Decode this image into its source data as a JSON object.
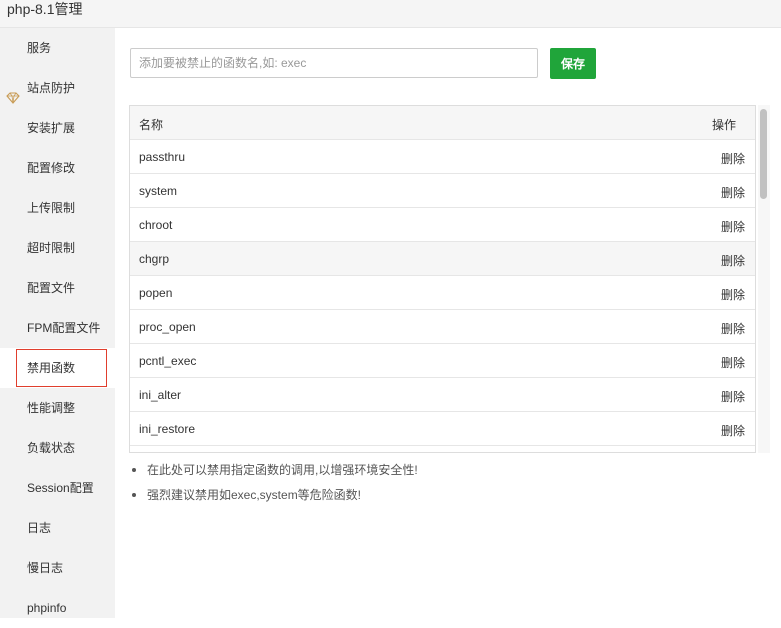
{
  "window": {
    "title": "php-8.1管理"
  },
  "sidebar": {
    "items": [
      {
        "label": "服务"
      },
      {
        "label": "站点防护",
        "icon": "diamond-icon"
      },
      {
        "label": "安装扩展"
      },
      {
        "label": "配置修改"
      },
      {
        "label": "上传限制"
      },
      {
        "label": "超时限制"
      },
      {
        "label": "配置文件"
      },
      {
        "label": "FPM配置文件"
      },
      {
        "label": "禁用函数",
        "active": true
      },
      {
        "label": "性能调整"
      },
      {
        "label": "负载状态"
      },
      {
        "label": "Session配置"
      },
      {
        "label": "日志"
      },
      {
        "label": "慢日志"
      },
      {
        "label": "phpinfo"
      }
    ]
  },
  "form": {
    "placeholder": "添加要被禁止的函数名,如: exec",
    "value": "",
    "save_label": "保存"
  },
  "table": {
    "headers": {
      "name": "名称",
      "action": "操作"
    },
    "rows": [
      {
        "name": "passthru",
        "action": "删除"
      },
      {
        "name": "system",
        "action": "删除"
      },
      {
        "name": "chroot",
        "action": "删除"
      },
      {
        "name": "chgrp",
        "action": "删除",
        "hover": true
      },
      {
        "name": "popen",
        "action": "删除"
      },
      {
        "name": "proc_open",
        "action": "删除"
      },
      {
        "name": "pcntl_exec",
        "action": "删除"
      },
      {
        "name": "ini_alter",
        "action": "删除"
      },
      {
        "name": "ini_restore",
        "action": "删除"
      }
    ]
  },
  "tips": [
    "在此处可以禁用指定函数的调用,以增强环境安全性!",
    "强烈建议禁用如exec,system等危险函数!"
  ],
  "colors": {
    "accent": "#20a53a",
    "active_border": "#e03e2d"
  }
}
